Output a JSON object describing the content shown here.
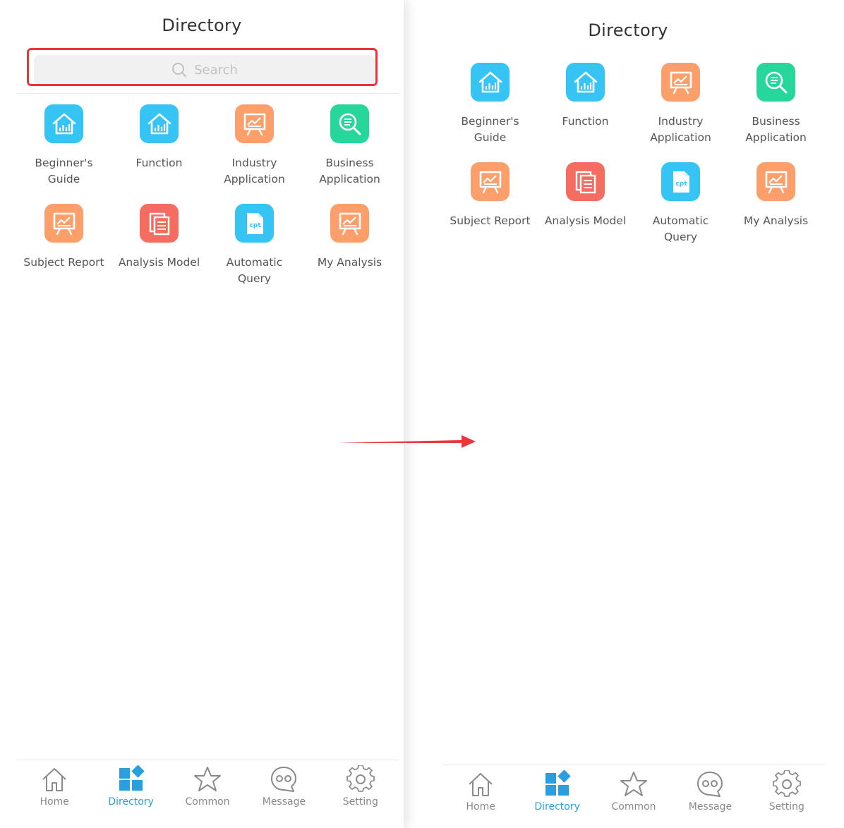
{
  "left_screen": {
    "title": "Directory",
    "search": {
      "placeholder": "Search",
      "icon": "search-icon"
    },
    "items": [
      {
        "label": "Beginner's\nGuide",
        "icon": "house-chart-icon",
        "color": "#36c4f4"
      },
      {
        "label": "Function",
        "icon": "house-chart-icon",
        "color": "#36c4f4"
      },
      {
        "label": "Industry\nApplication",
        "icon": "presentation-board-icon",
        "color": "#fc9f6b"
      },
      {
        "label": "Business\nApplication",
        "icon": "magnifier-list-icon",
        "color": "#27d69a"
      },
      {
        "label": "Subject Report",
        "icon": "presentation-board-icon",
        "color": "#fc9f6b"
      },
      {
        "label": "Analysis Model",
        "icon": "documents-icon",
        "color": "#f56d61"
      },
      {
        "label": "Automatic\nQuery",
        "icon": "cpt-file-icon",
        "color": "#36c4f4"
      },
      {
        "label": "My Analysis",
        "icon": "presentation-board-icon",
        "color": "#fc9f6b"
      }
    ],
    "tabs": [
      {
        "label": "Home",
        "icon": "home-icon",
        "active": false
      },
      {
        "label": "Directory",
        "icon": "directory-icon",
        "active": true
      },
      {
        "label": "Common",
        "icon": "star-icon",
        "active": false
      },
      {
        "label": "Message",
        "icon": "message-icon",
        "active": false
      },
      {
        "label": "Setting",
        "icon": "gear-icon",
        "active": false
      }
    ]
  },
  "right_screen": {
    "title": "Directory",
    "items": [
      {
        "label": "Beginner's\nGuide",
        "icon": "house-chart-icon",
        "color": "#36c4f4"
      },
      {
        "label": "Function",
        "icon": "house-chart-icon",
        "color": "#36c4f4"
      },
      {
        "label": "Industry\nApplication",
        "icon": "presentation-board-icon",
        "color": "#fc9f6b"
      },
      {
        "label": "Business\nApplication",
        "icon": "magnifier-list-icon",
        "color": "#27d69a"
      },
      {
        "label": "Subject Report",
        "icon": "presentation-board-icon",
        "color": "#fc9f6b"
      },
      {
        "label": "Analysis Model",
        "icon": "documents-icon",
        "color": "#f56d61"
      },
      {
        "label": "Automatic\nQuery",
        "icon": "cpt-file-icon",
        "color": "#36c4f4"
      },
      {
        "label": "My Analysis",
        "icon": "presentation-board-icon",
        "color": "#fc9f6b"
      }
    ],
    "tabs": [
      {
        "label": "Home",
        "icon": "home-icon",
        "active": false
      },
      {
        "label": "Directory",
        "icon": "directory-icon",
        "active": true
      },
      {
        "label": "Common",
        "icon": "star-icon",
        "active": false
      },
      {
        "label": "Message",
        "icon": "message-icon",
        "active": false
      },
      {
        "label": "Setting",
        "icon": "gear-icon",
        "active": false
      }
    ]
  },
  "colors": {
    "accent": "#2a9fe0",
    "highlight_border": "#e8363b",
    "arrow": "#e8363b"
  }
}
